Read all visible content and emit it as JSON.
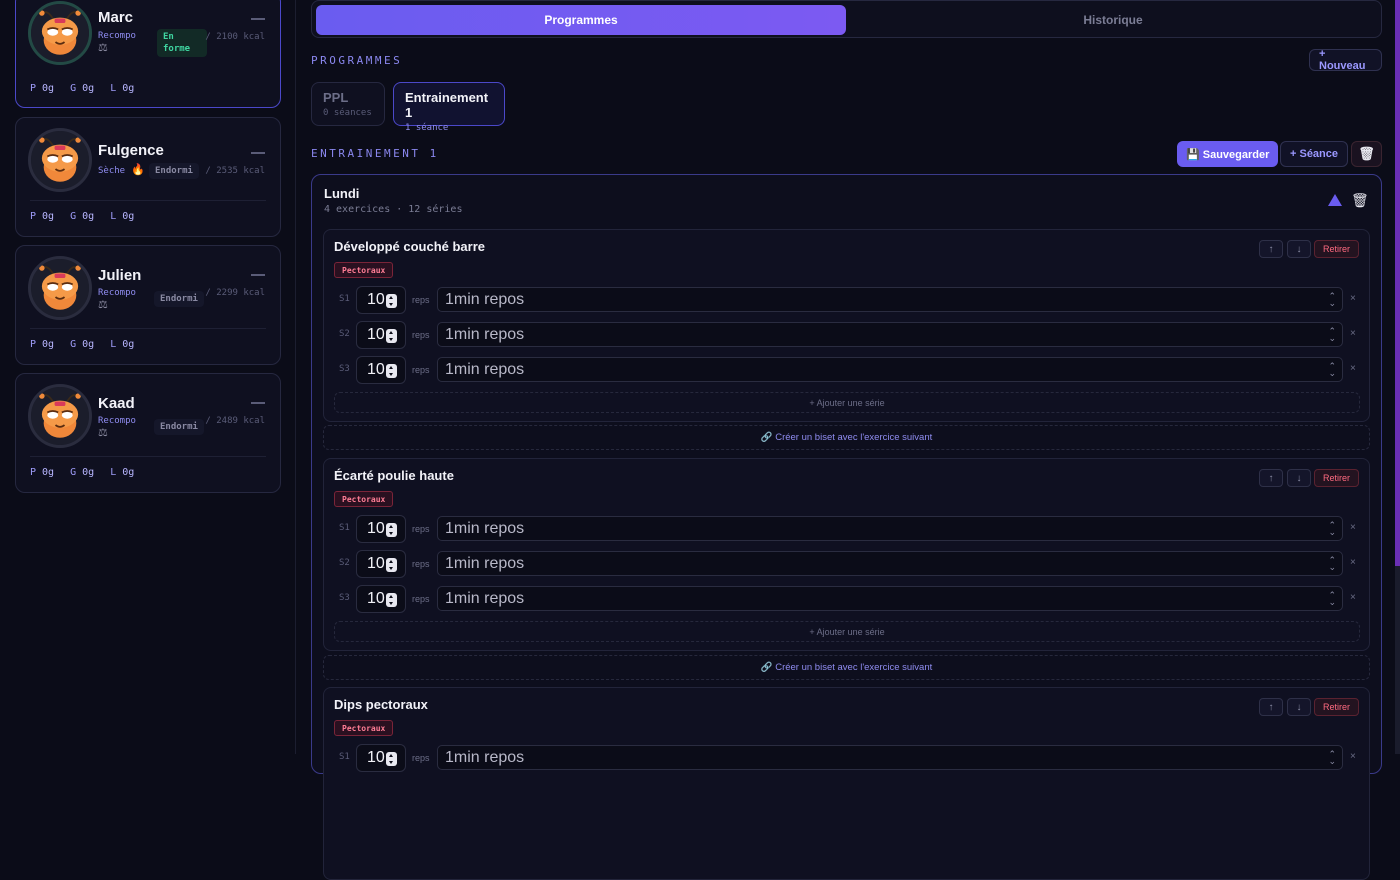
{
  "sidebar": {
    "users": [
      {
        "name": "Marc",
        "goal": "Recompo",
        "state": "En forme",
        "kcal": "/ 2100 kcal",
        "macros": {
          "p": "0g",
          "g": "0g",
          "l": "0g"
        }
      },
      {
        "name": "Fulgence",
        "goal": "Sèche",
        "state": "Endormi",
        "kcal": "/ 2535 kcal",
        "macros": {
          "p": "0g",
          "g": "0g",
          "l": "0g"
        }
      },
      {
        "name": "Julien",
        "goal": "Recompo",
        "state": "Endormi",
        "kcal": "/ 2299 kcal",
        "macros": {
          "p": "0g",
          "g": "0g",
          "l": "0g"
        }
      },
      {
        "name": "Kaad",
        "goal": "Recompo",
        "state": "Endormi",
        "kcal": "/ 2489 kcal",
        "macros": {
          "p": "0g",
          "g": "0g",
          "l": "0g"
        }
      }
    ],
    "macro_labels": {
      "p": "P",
      "g": "G",
      "l": "L"
    }
  },
  "tabs": {
    "programmes": "Programmes",
    "historique": "Historique"
  },
  "programmes_section": {
    "label": "PROGRAMMES",
    "new_button": "+ Nouveau"
  },
  "programs": [
    {
      "name": "PPL",
      "sessions": "0 séances"
    },
    {
      "name": "Entrainement 1",
      "sessions": "1 séance"
    }
  ],
  "program_section": {
    "label": "ENTRAINEMENT 1",
    "save_button": "💾 Sauvegarder",
    "add_session_button": "+ Séance"
  },
  "day": {
    "title": "Lundi",
    "summary": "4 exercices · 12 séries",
    "exercises": [
      {
        "name": "Développé couché barre",
        "muscle": "Pectoraux",
        "sets": [
          {
            "label": "S1",
            "reps": "10",
            "rest": "1min repos"
          },
          {
            "label": "S2",
            "reps": "10",
            "rest": "1min repos"
          },
          {
            "label": "S3",
            "reps": "10",
            "rest": "1min repos"
          }
        ]
      },
      {
        "name": "Écarté poulie haute",
        "muscle": "Pectoraux",
        "sets": [
          {
            "label": "S1",
            "reps": "10",
            "rest": "1min repos"
          },
          {
            "label": "S2",
            "reps": "10",
            "rest": "1min repos"
          },
          {
            "label": "S3",
            "reps": "10",
            "rest": "1min repos"
          }
        ]
      },
      {
        "name": "Dips pectoraux",
        "muscle": "Pectoraux",
        "sets": [
          {
            "label": "S1",
            "reps": "10",
            "rest": "1min repos"
          }
        ]
      }
    ]
  },
  "labels": {
    "reps": "reps",
    "retire": "Retirer",
    "add_set": "+ Ajouter une série",
    "biset": "🔗 Créer un biset avec l'exercice suivant",
    "remove_set": "×",
    "up": "↑",
    "down": "↓"
  },
  "colors": {
    "accent": "#6a5cf0",
    "danger": "#ff6a80",
    "ok": "#3fd6a1"
  }
}
